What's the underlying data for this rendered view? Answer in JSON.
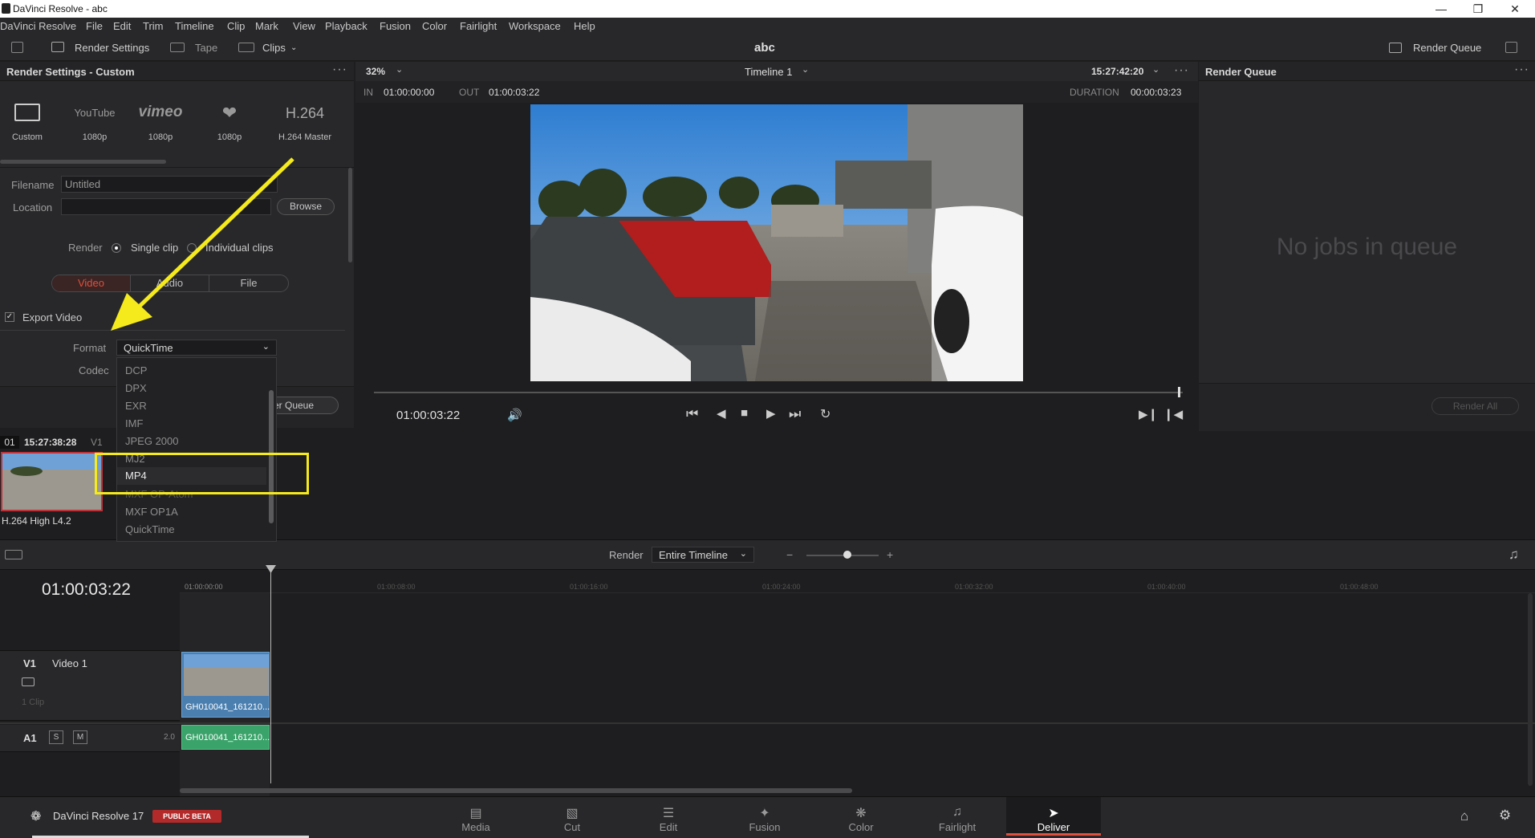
{
  "window": {
    "title": "DaVinci Resolve - abc"
  },
  "menu": [
    "DaVinci Resolve",
    "File",
    "Edit",
    "Trim",
    "Timeline",
    "Clip",
    "Mark",
    "View",
    "Playback",
    "Fusion",
    "Color",
    "Fairlight",
    "Workspace",
    "Help"
  ],
  "toolbar": {
    "render_settings": "Render Settings",
    "tape": "Tape",
    "clips": "Clips",
    "project": "abc",
    "render_queue": "Render Queue"
  },
  "render_settings": {
    "header": "Render Settings - Custom",
    "presets": [
      {
        "name": "Custom",
        "label": "Custom"
      },
      {
        "name": "YouTube",
        "label": "1080p"
      },
      {
        "name": "vimeo",
        "label": "1080p"
      },
      {
        "name": "Twitter",
        "label": "1080p"
      },
      {
        "name": "H.264",
        "label": "H.264 Master"
      }
    ],
    "filename_label": "Filename",
    "filename_value": "Untitled",
    "location_label": "Location",
    "browse": "Browse",
    "render_label": "Render",
    "single_clip": "Single clip",
    "individual_clips": "Individual clips",
    "tabs": [
      "Video",
      "Audio",
      "File"
    ],
    "export_video": "Export Video",
    "format_label": "Format",
    "format_value": "QuickTime",
    "codec_label": "Codec",
    "add_queue": "er Queue"
  },
  "format_options": [
    "DCP",
    "DPX",
    "EXR",
    "IMF",
    "JPEG 2000",
    "MJ2",
    "MP4",
    "MXF OP-Atom",
    "MXF OP1A",
    "QuickTime"
  ],
  "format_selected": "MP4",
  "viewer": {
    "zoom": "32%",
    "timeline_name": "Timeline 1",
    "timecode": "15:27:42:20",
    "in_label": "IN",
    "in_value": "01:00:00:00",
    "out_label": "OUT",
    "out_value": "01:00:03:22",
    "duration_label": "DURATION",
    "duration_value": "00:00:03:23",
    "current_tc": "01:00:03:22"
  },
  "render_queue": {
    "header": "Render Queue",
    "empty": "No jobs in queue",
    "render_all": "Render All"
  },
  "clip": {
    "number": "01",
    "timecode": "15:27:38:28",
    "track": "V1",
    "codec": "H.264 High L4.2"
  },
  "timeline": {
    "render_label": "Render",
    "render_value": "Entire Timeline",
    "current_tc": "01:00:03:22",
    "ruler": [
      "01:00:00:00",
      "01:00:08:00",
      "01:00:16:00",
      "01:00:24:00",
      "01:00:32:00",
      "01:00:40:00",
      "01:00:48:00"
    ],
    "v1_label": "V1",
    "v1_name": "Video 1",
    "v1_count": "1 Clip",
    "a1_label": "A1",
    "a1_s": "S",
    "a1_m": "M",
    "a1_ch": "2.0",
    "clip_name": "GH010041_161210...",
    "audio_clip_name": "GH010041_161210..."
  },
  "bottom": {
    "app": "DaVinci Resolve 17",
    "beta": "PUBLIC BETA",
    "pages": [
      "Media",
      "Cut",
      "Edit",
      "Fusion",
      "Color",
      "Fairlight",
      "Deliver"
    ],
    "active_page": "Deliver"
  },
  "colors": {
    "accent": "#e0503c",
    "highlight": "#f5ea1c",
    "audio_clip": "#3aa36a",
    "video_clip": "#4a7fb0"
  }
}
